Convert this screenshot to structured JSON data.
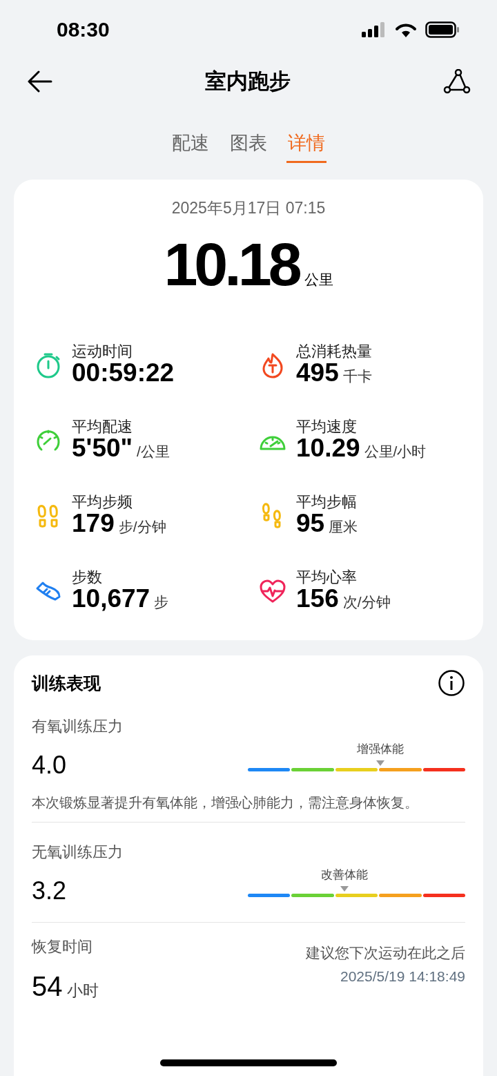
{
  "status_bar": {
    "time": "08:30"
  },
  "header": {
    "title": "室内跑步"
  },
  "tabs": [
    {
      "label": "配速",
      "selected": false
    },
    {
      "label": "图表",
      "selected": false
    },
    {
      "label": "详情",
      "selected": true
    }
  ],
  "summary": {
    "datetime": "2025年5月17日 07:15",
    "distance": "10.18",
    "distance_unit": "公里",
    "stats": [
      {
        "kind": "stopwatch",
        "color": "#1ec98a",
        "label": "运动时间",
        "value": "00:59:22"
      },
      {
        "kind": "flame",
        "color": "#f2481f",
        "label": "总消耗热量",
        "value": "495",
        "unit": "千卡"
      },
      {
        "kind": "gauge",
        "color": "#3fcf3a",
        "label": "平均配速",
        "value": "5'50\"",
        "unit": "/公里"
      },
      {
        "kind": "speedometer",
        "color": "#3fcf3a",
        "label": "平均速度",
        "value": "10.29",
        "unit": "公里/小时"
      },
      {
        "kind": "footprints",
        "color": "#f5b90f",
        "label": "平均步频",
        "value": "179",
        "unit": "步/分钟"
      },
      {
        "kind": "steps",
        "color": "#f5b90f",
        "label": "平均步幅",
        "value": "95",
        "unit": "厘米"
      },
      {
        "kind": "shoe",
        "color": "#1f7ff0",
        "label": "步数",
        "value": "10,677",
        "unit": "步"
      },
      {
        "kind": "heart",
        "color": "#f0245a",
        "label": "平均心率",
        "value": "156",
        "unit": "次/分钟"
      }
    ]
  },
  "training": {
    "title": "训练表现",
    "pressures": [
      {
        "label": "有氧训练压力",
        "value": "4.0",
        "marker_label": "增强体能",
        "level": 0.61,
        "note": "本次锻炼显著提升有氧体能，增强心肺能力，需注意身体恢复。"
      },
      {
        "label": "无氧训练压力",
        "value": "3.2",
        "marker_label": "改善体能",
        "level": 0.445
      }
    ],
    "recovery": {
      "label": "恢复时间",
      "value": "54",
      "unit": "小时",
      "advice": "建议您下次运动在此之后",
      "until": "2025/5/19 14:18:49"
    }
  }
}
